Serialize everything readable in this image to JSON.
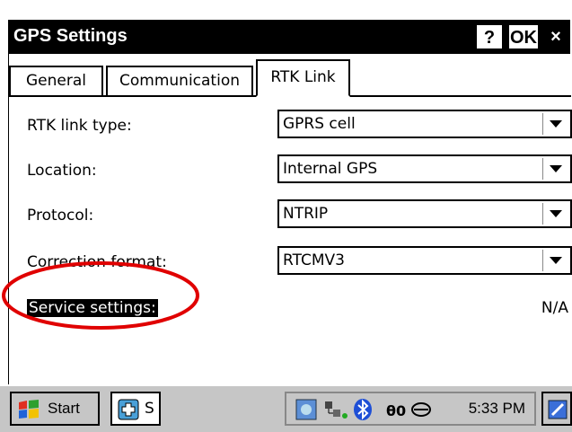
{
  "window": {
    "title": "GPS Settings",
    "help_label": "?",
    "ok_label": "OK",
    "close_label": "×"
  },
  "tabs": [
    {
      "label": "General",
      "active": false
    },
    {
      "label": "Communication",
      "active": false
    },
    {
      "label": "RTK Link",
      "active": true
    }
  ],
  "form": {
    "rows": [
      {
        "label": "RTK link type:",
        "value": "GPRS cell"
      },
      {
        "label": "Location:",
        "value": "Internal GPS"
      },
      {
        "label": "Protocol:",
        "value": "NTRIP"
      },
      {
        "label": "Correction format:",
        "value": "RTCMV3"
      }
    ],
    "service_settings_label": "Service settings:",
    "service_settings_value": "N/A"
  },
  "taskbar": {
    "start_label": "Start",
    "task_label": "S",
    "clock": "5:33 PM",
    "tray_icons": [
      "network-icon",
      "connection-icon",
      "bluetooth-icon",
      "volume-icon",
      "cloud-icon"
    ]
  },
  "colors": {
    "annotation_circle": "#e00000",
    "titlebar_bg": "#000000",
    "taskbar_bg": "#c6c6c6"
  }
}
